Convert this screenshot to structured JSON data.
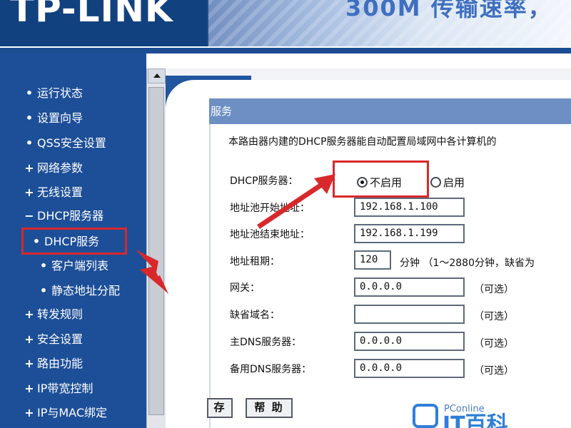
{
  "header": {
    "logo_text": "TP-LINK",
    "slogan": "300M 传输速率，"
  },
  "sidebar": {
    "items": [
      {
        "bullet": "•",
        "label": "运行状态"
      },
      {
        "bullet": "•",
        "label": "设置向导"
      },
      {
        "bullet": "•",
        "label": "QSS安全设置"
      },
      {
        "bullet": "+",
        "label": "网络参数"
      },
      {
        "bullet": "+",
        "label": "无线设置"
      },
      {
        "bullet": "−",
        "label": "DHCP服务器"
      },
      {
        "bullet": "•",
        "label": "DHCP服务"
      },
      {
        "bullet": "•",
        "label": "客户端列表"
      },
      {
        "bullet": "•",
        "label": "静态地址分配"
      },
      {
        "bullet": "+",
        "label": "转发规则"
      },
      {
        "bullet": "+",
        "label": "安全设置"
      },
      {
        "bullet": "+",
        "label": "路由功能"
      },
      {
        "bullet": "+",
        "label": "IP带宽控制"
      },
      {
        "bullet": "+",
        "label": "IP与MAC绑定"
      }
    ]
  },
  "main": {
    "title": "服务",
    "description": "本路由器内建的DHCP服务器能自动配置局域网中各计算机的",
    "dhcp_server": {
      "label": "DHCP服务器：",
      "option_disable": "不启用",
      "option_enable": "启用",
      "selected": "不启用"
    },
    "fields": {
      "start_ip": {
        "label": "地址池开始地址：",
        "value": "192.168.1.100"
      },
      "end_ip": {
        "label": "地址池结束地址：",
        "value": "192.168.1.199"
      },
      "lease": {
        "label": "地址租期：",
        "value": "120",
        "hint": "分钟 （1～2880分钟，缺省为"
      },
      "gateway": {
        "label": "网关：",
        "value": "0.0.0.0",
        "hint": "（可选）"
      },
      "domain": {
        "label": "缺省域名：",
        "value": "",
        "hint": "（可选）"
      },
      "primary_dns": {
        "label": "主DNS服务器：",
        "value": "0.0.0.0",
        "hint": "（可选）"
      },
      "secondary_dns": {
        "label": "备用DNS服务器：",
        "value": "0.0.0.0",
        "hint": "（可选）"
      }
    },
    "buttons": {
      "save": "存",
      "help": "帮 助"
    }
  },
  "watermark": {
    "sub": "PConline",
    "main": "IT百科"
  },
  "colors": {
    "sidebar_bg": "#1d4f98",
    "title_bar": "#6d8fc4",
    "annotation_red": "#d9282b"
  }
}
